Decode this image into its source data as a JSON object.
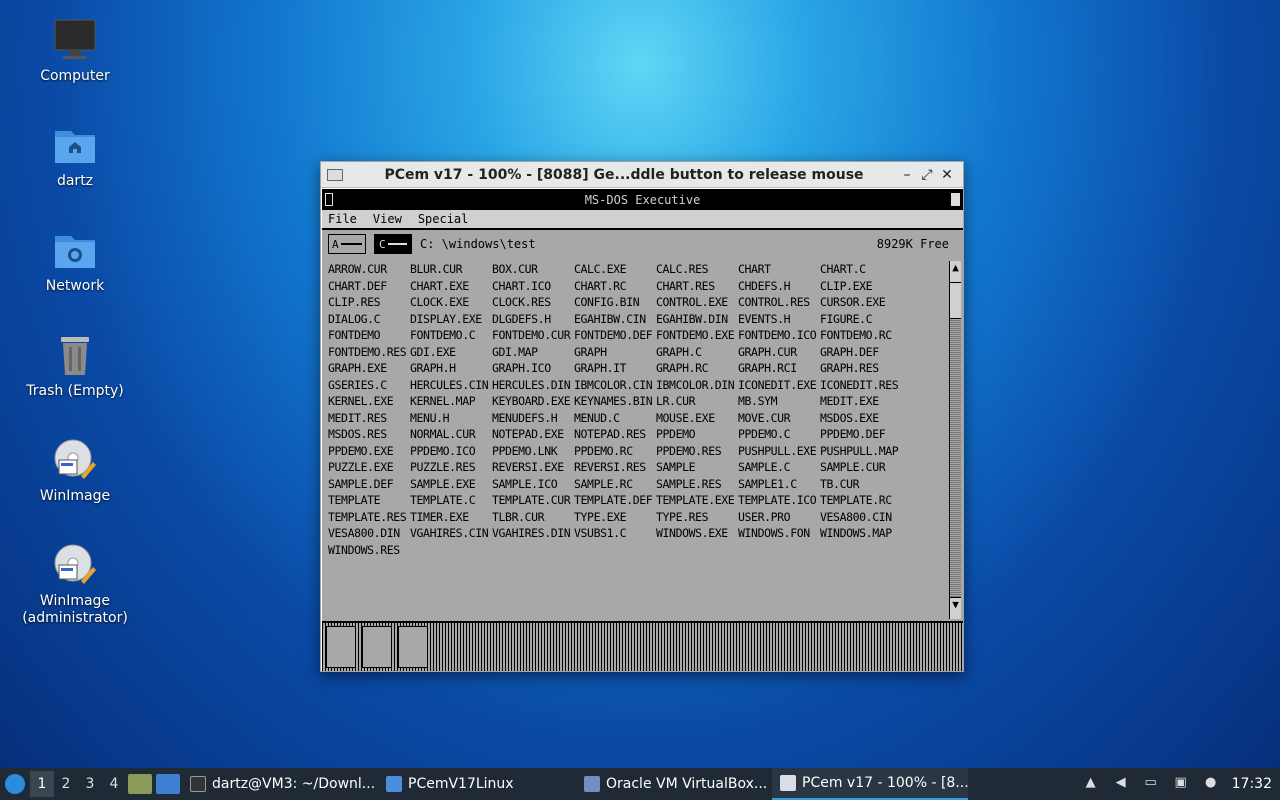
{
  "desktop_icons": [
    {
      "label": "Computer",
      "icon": "monitor-icon"
    },
    {
      "label": "dartz",
      "icon": "home-folder-icon"
    },
    {
      "label": "Network",
      "icon": "network-folder-icon"
    },
    {
      "label": "Trash (Empty)",
      "icon": "trash-icon"
    },
    {
      "label": "WinImage",
      "icon": "winimage-icon"
    },
    {
      "label": "WinImage\n(administrator)",
      "icon": "winimage-icon"
    }
  ],
  "pcem_window": {
    "title": "PCem v17 - 100% - [8088] Ge...ddle button to release mouse",
    "controls": {
      "minimize": "–",
      "maximize": "⤢",
      "close": "✕"
    }
  },
  "dos_executive": {
    "title": "MS-DOS Executive",
    "menu": [
      "File",
      "View",
      "Special"
    ],
    "drives": [
      "A",
      "C"
    ],
    "selected_drive": "C",
    "path": "C: \\windows\\test",
    "free": "8929K Free",
    "files": [
      "ARROW.CUR",
      "BLUR.CUR",
      "BOX.CUR",
      "CALC.EXE",
      "CALC.RES",
      "CHART",
      "CHART.C",
      "CHART.DEF",
      "CHART.EXE",
      "CHART.ICO",
      "CHART.RC",
      "CHART.RES",
      "CHDEFS.H",
      "CLIP.EXE",
      "CLIP.RES",
      "CLOCK.EXE",
      "CLOCK.RES",
      "CONFIG.BIN",
      "CONTROL.EXE",
      "CONTROL.RES",
      "CURSOR.EXE",
      "DIALOG.C",
      "DISPLAY.EXE",
      "DLGDEFS.H",
      "EGAHIBW.CIN",
      "EGAHIBW.DIN",
      "EVENTS.H",
      "FIGURE.C",
      "FONTDEMO",
      "FONTDEMO.C",
      "FONTDEMO.CUR",
      "FONTDEMO.DEF",
      "FONTDEMO.EXE",
      "FONTDEMO.ICO",
      "FONTDEMO.RC",
      "FONTDEMO.RES",
      "GDI.EXE",
      "GDI.MAP",
      "GRAPH",
      "GRAPH.C",
      "GRAPH.CUR",
      "GRAPH.DEF",
      "GRAPH.EXE",
      "GRAPH.H",
      "GRAPH.ICO",
      "GRAPH.IT",
      "GRAPH.RC",
      "GRAPH.RCI",
      "GRAPH.RES",
      "GSERIES.C",
      "HERCULES.CIN",
      "HERCULES.DIN",
      "IBMCOLOR.CIN",
      "IBMCOLOR.DIN",
      "ICONEDIT.EXE",
      "ICONEDIT.RES",
      "KERNEL.EXE",
      "KERNEL.MAP",
      "KEYBOARD.EXE",
      "KEYNAMES.BIN",
      "LR.CUR",
      "MB.SYM",
      "MEDIT.EXE",
      "MEDIT.RES",
      "MENU.H",
      "MENUDEFS.H",
      "MENUD.C",
      "MOUSE.EXE",
      "MOVE.CUR",
      "MSDOS.EXE",
      "MSDOS.RES",
      "NORMAL.CUR",
      "NOTEPAD.EXE",
      "NOTEPAD.RES",
      "PPDEMO",
      "PPDEMO.C",
      "PPDEMO.DEF",
      "PPDEMO.EXE",
      "PPDEMO.ICO",
      "PPDEMO.LNK",
      "PPDEMO.RC",
      "PPDEMO.RES",
      "PUSHPULL.EXE",
      "PUSHPULL.MAP",
      "PUZZLE.EXE",
      "PUZZLE.RES",
      "REVERSI.EXE",
      "REVERSI.RES",
      "SAMPLE",
      "SAMPLE.C",
      "SAMPLE.CUR",
      "SAMPLE.DEF",
      "SAMPLE.EXE",
      "SAMPLE.ICO",
      "SAMPLE.RC",
      "SAMPLE.RES",
      "SAMPLE1.C",
      "TB.CUR",
      "TEMPLATE",
      "TEMPLATE.C",
      "TEMPLATE.CUR",
      "TEMPLATE.DEF",
      "TEMPLATE.EXE",
      "TEMPLATE.ICO",
      "TEMPLATE.RC",
      "TEMPLATE.RES",
      "TIMER.EXE",
      "TLBR.CUR",
      "TYPE.EXE",
      "TYPE.RES",
      "USER.PRO",
      "VESA800.CIN",
      "VESA800.DIN",
      "VGAHIRES.CIN",
      "VGAHIRES.DIN",
      "VSUBS1.C",
      "WINDOWS.EXE",
      "WINDOWS.FON",
      "WINDOWS.MAP",
      "WINDOWS.RES"
    ]
  },
  "taskbar": {
    "workspaces": [
      "1",
      "2",
      "3",
      "4"
    ],
    "active_workspace": "1",
    "tasks": [
      {
        "label": "dartz@VM3: ~/Downl...",
        "icon": "terminal-icon"
      },
      {
        "label": "PCemV17Linux",
        "icon": "folder-icon"
      },
      {
        "label": "Oracle VM VirtualBox...",
        "icon": "virtualbox-icon"
      },
      {
        "label": "PCem v17 - 100% - [8...",
        "icon": "pcem-icon",
        "active": true
      }
    ],
    "clock": "17:32"
  }
}
